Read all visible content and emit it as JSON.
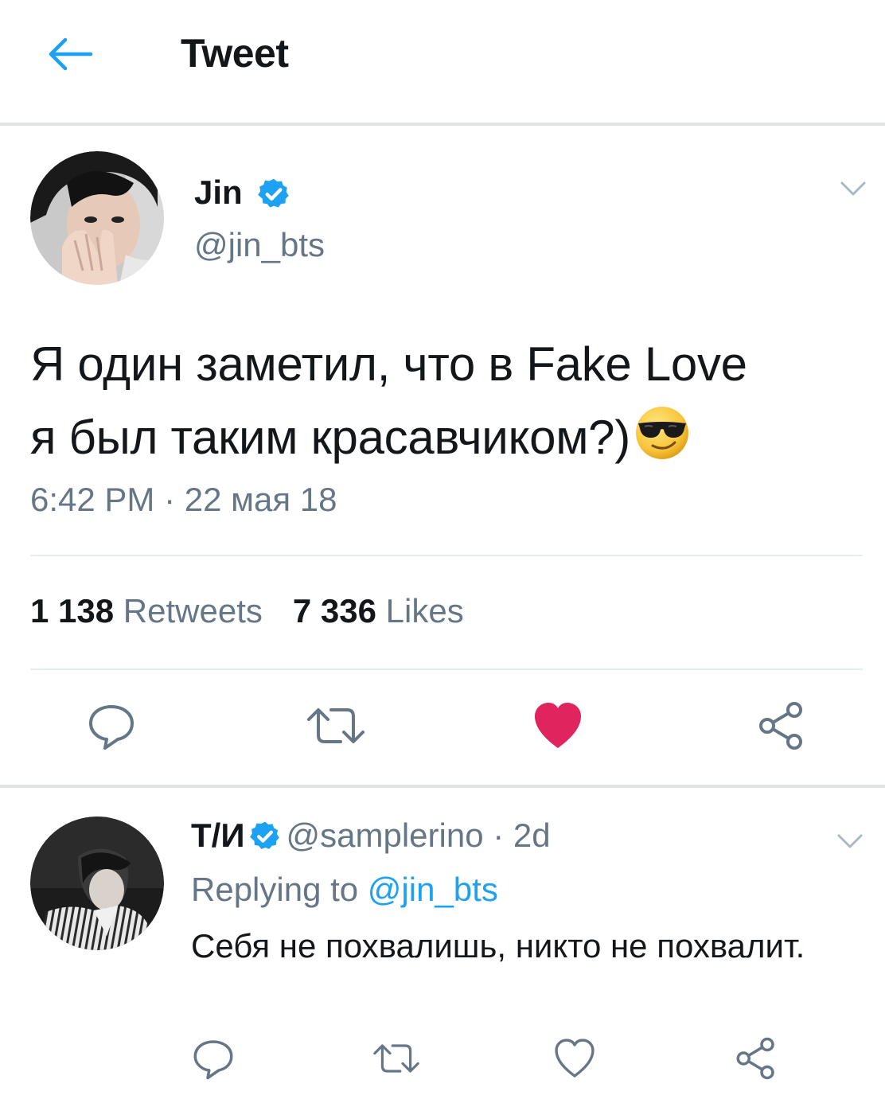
{
  "colors": {
    "accent": "#1da1f2",
    "text_primary": "#14171a",
    "text_secondary": "#657786",
    "like_red": "#e0245e",
    "divider": "#e6ecf0"
  },
  "header": {
    "back_icon": "arrow-left-icon",
    "title": "Tweet"
  },
  "tweet": {
    "author": {
      "name": "Jin",
      "verified": true,
      "handle": "@jin_bts"
    },
    "text_line1": "Я один заметил, что в Fake Love",
    "text_line2": "я был таким красавчиком?)",
    "emoji": "smiling-face-with-sunglasses",
    "timestamp": "6:42 PM · 22 мая 18",
    "stats": {
      "retweets_count": "1 138",
      "retweets_label": "Retweets",
      "likes_count": "7 336",
      "likes_label": "Likes"
    },
    "actions": {
      "reply_icon": "reply-icon",
      "retweet_icon": "retweet-icon",
      "like_icon": "heart-icon",
      "liked": true,
      "share_icon": "share-icon"
    }
  },
  "reply": {
    "author": {
      "name": "Т/И",
      "verified": true,
      "handle": "@samplerino",
      "time": "· 2d"
    },
    "replying_to_label": "Replying to",
    "replying_to_handle": "@jin_bts",
    "text": "Себя не похвалишь, никто не похвалит.",
    "actions": {
      "reply_icon": "reply-icon",
      "retweet_icon": "retweet-icon",
      "like_icon": "heart-outline-icon",
      "liked": false,
      "share_icon": "share-icon"
    }
  }
}
